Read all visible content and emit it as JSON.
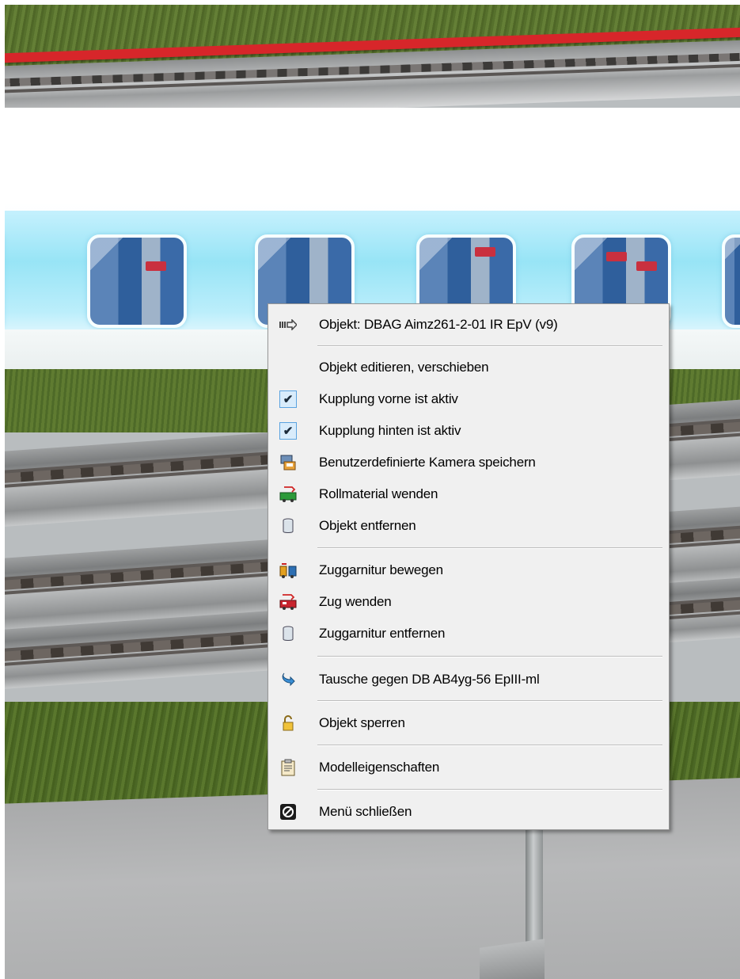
{
  "context_menu": {
    "header": {
      "label": "Objekt: DBAG Aimz261-2-01 IR EpV (v9)",
      "icon": "train-arrow-icon"
    },
    "items": [
      {
        "label": "Objekt editieren, verschieben",
        "icon": ""
      },
      {
        "label": "Kupplung vorne ist aktiv",
        "icon": "checkmark-icon",
        "checked": true
      },
      {
        "label": "Kupplung hinten ist aktiv",
        "icon": "checkmark-icon",
        "checked": true
      },
      {
        "label": "Benutzerdefinierte Kamera speichern",
        "icon": "camera-save-icon"
      },
      {
        "label": "Rollmaterial wenden",
        "icon": "railcar-turn-icon"
      },
      {
        "label": "Objekt entfernen",
        "icon": "trash-bin-icon"
      },
      {
        "label": "Zuggarnitur bewegen",
        "icon": "train-move-icon"
      },
      {
        "label": "Zug wenden",
        "icon": "train-turn-icon"
      },
      {
        "label": "Zuggarnitur entfernen",
        "icon": "trash-bin-icon"
      },
      {
        "label": "Tausche gegen DB AB4yg-56 EpIII-ml",
        "icon": "swap-arrow-icon"
      },
      {
        "label": "Objekt sperren",
        "icon": "padlock-icon"
      },
      {
        "label": "Modelleigenschaften",
        "icon": "clipboard-icon"
      },
      {
        "label": "Menü schließen",
        "icon": "close-circle-icon"
      }
    ]
  },
  "colors": {
    "menu_background": "#f0f0f0",
    "menu_border": "#979797",
    "check_highlight": "#d9ecfb"
  }
}
